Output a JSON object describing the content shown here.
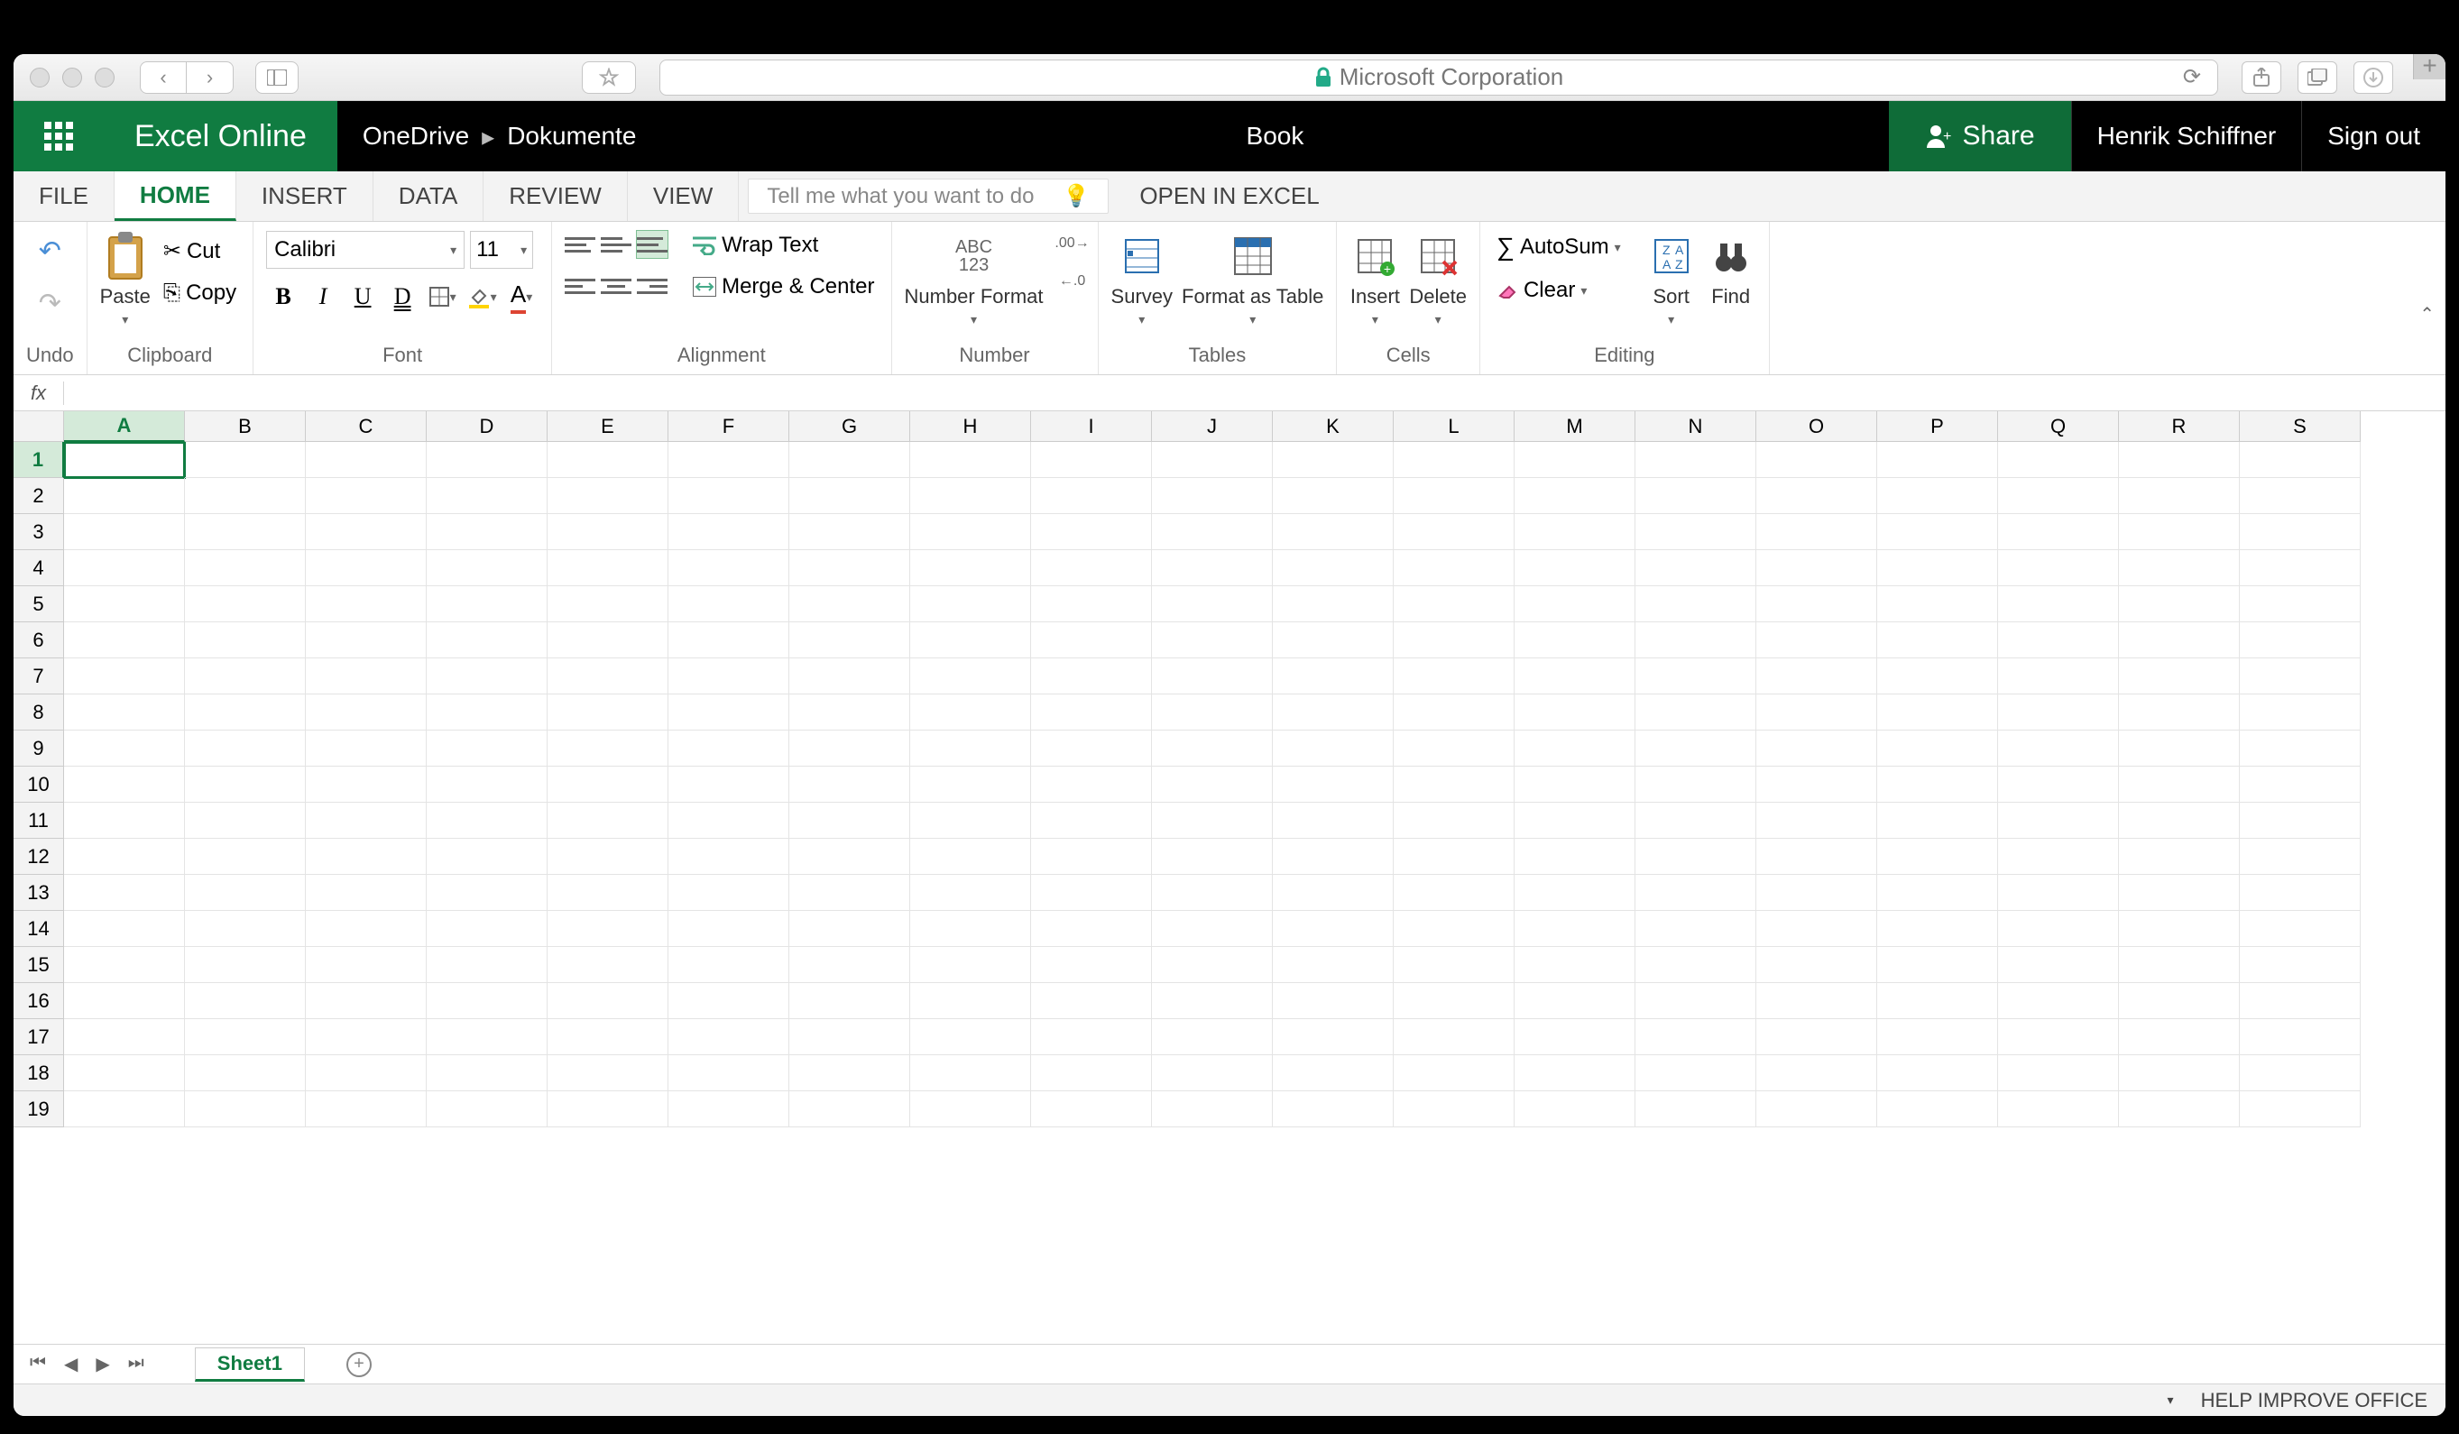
{
  "browser": {
    "address": "Microsoft Corporation"
  },
  "app": {
    "name": "Excel Online",
    "breadcrumb": [
      "OneDrive",
      "Dokumente"
    ],
    "document_title": "Book",
    "share_label": "Share",
    "user": "Henrik Schiffner",
    "signout": "Sign out"
  },
  "tabs": {
    "items": [
      "FILE",
      "HOME",
      "INSERT",
      "DATA",
      "REVIEW",
      "VIEW"
    ],
    "active": "HOME",
    "tell_me_placeholder": "Tell me what you want to do",
    "open_in": "OPEN IN EXCEL"
  },
  "ribbon": {
    "undo": {
      "label": "Undo"
    },
    "clipboard": {
      "label": "Clipboard",
      "paste": "Paste",
      "cut": "Cut",
      "copy": "Copy"
    },
    "font": {
      "label": "Font",
      "name": "Calibri",
      "size": "11"
    },
    "alignment": {
      "label": "Alignment",
      "wrap": "Wrap Text",
      "merge": "Merge & Center"
    },
    "number": {
      "label": "Number",
      "format": "Number Format"
    },
    "tables": {
      "label": "Tables",
      "survey": "Survey",
      "format_table": "Format as Table"
    },
    "cells": {
      "label": "Cells",
      "insert": "Insert",
      "delete": "Delete"
    },
    "editing": {
      "label": "Editing",
      "autosum": "AutoSum",
      "clear": "Clear",
      "sort": "Sort",
      "find": "Find"
    }
  },
  "grid": {
    "columns": [
      "A",
      "B",
      "C",
      "D",
      "E",
      "F",
      "G",
      "H",
      "I",
      "J",
      "K",
      "L",
      "M",
      "N",
      "O",
      "P",
      "Q",
      "R",
      "S"
    ],
    "rows": [
      1,
      2,
      3,
      4,
      5,
      6,
      7,
      8,
      9,
      10,
      11,
      12,
      13,
      14,
      15,
      16,
      17,
      18,
      19
    ],
    "selected": {
      "col": "A",
      "row": 1
    }
  },
  "sheets": {
    "active": "Sheet1"
  },
  "status": {
    "help": "HELP IMPROVE OFFICE"
  }
}
